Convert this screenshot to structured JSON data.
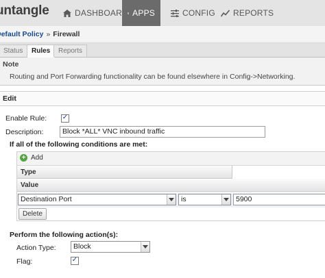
{
  "app": {
    "logo": "untangle"
  },
  "nav": {
    "items": [
      {
        "label": "DASHBOARD",
        "icon": "home-icon"
      },
      {
        "label": "APPS",
        "icon": "grid-icon"
      },
      {
        "label": "CONFIG",
        "icon": "sliders-icon"
      },
      {
        "label": "REPORTS",
        "icon": "chart-line-icon"
      }
    ],
    "active": "APPS"
  },
  "breadcrumb": {
    "parent": "Default Policy",
    "separator": "»",
    "current": "Firewall"
  },
  "tabs": [
    {
      "label": "Status"
    },
    {
      "label": "Rules"
    },
    {
      "label": "Reports"
    }
  ],
  "active_tab": "Rules",
  "note": {
    "title": "Note",
    "text": "Routing and Port Forwarding functionality can be found elsewhere in Config->Networking."
  },
  "edit": {
    "title": "Edit",
    "enable_rule_label": "Enable Rule:",
    "enable_rule_checked": true,
    "description_label": "Description:",
    "description_value": "Block *ALL* VNC inbound traffic",
    "conditions_title": "If all of the following conditions are met:",
    "add_label": "Add",
    "columns": {
      "type": "Type",
      "value": "Value"
    },
    "condition_row": {
      "type": "Destination Port",
      "operator": "is",
      "value": "5900"
    },
    "delete_label": "Delete",
    "actions_title": "Perform the following action(s):",
    "action_type_label": "Action Type:",
    "action_type_value": "Block",
    "flag_label": "Flag:",
    "flag_checked": true
  },
  "colors": {
    "nav_active_bg": "#6b6b6b",
    "add_icon": "#53a53f",
    "link": "#15498b"
  }
}
